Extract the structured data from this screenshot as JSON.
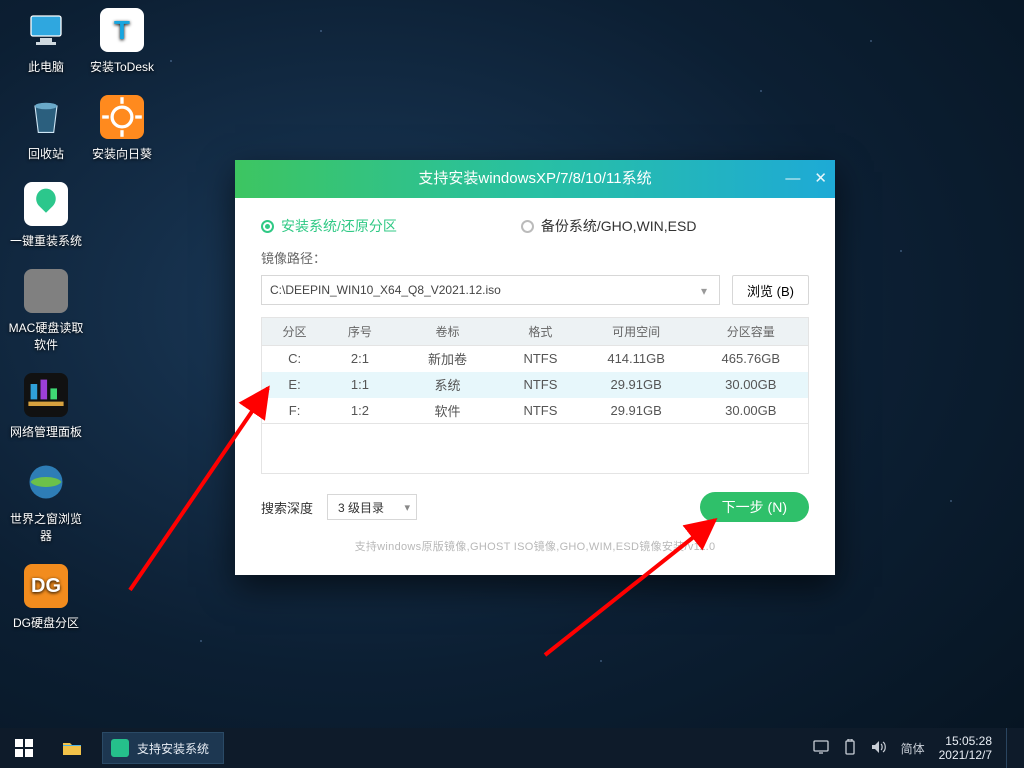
{
  "desktop": [
    {
      "name": "此电脑",
      "icon": "pc"
    },
    {
      "name": "回收站",
      "icon": "bin"
    },
    {
      "name": "一键重装系统",
      "icon": "cloud"
    },
    {
      "name": "MAC硬盘读取软件",
      "icon": "mac"
    },
    {
      "name": "网络管理面板",
      "icon": "net"
    },
    {
      "name": "世界之窗浏览器",
      "icon": "globe"
    },
    {
      "name": "DG硬盘分区",
      "icon": "dg"
    }
  ],
  "desktop_col2": [
    {
      "name": "安装ToDesk",
      "icon": "todesk"
    },
    {
      "name": "安装向日葵",
      "icon": "sun"
    }
  ],
  "installer": {
    "title": "支持安装windowsXP/7/8/10/11系统",
    "tab_install": "安装系统/还原分区",
    "tab_backup": "备份系统/GHO,WIN,ESD",
    "path_label": "镜像路径：",
    "path_value": "C:\\DEEPIN_WIN10_X64_Q8_V2021.12.iso",
    "browse": "浏览 (B)",
    "headers": {
      "part": "分区",
      "idx": "序号",
      "vol": "卷标",
      "fmt": "格式",
      "free": "可用空间",
      "cap": "分区容量"
    },
    "rows": [
      {
        "part": "C:",
        "idx": "2:1",
        "vol": "新加卷",
        "fmt": "NTFS",
        "free": "414.11GB",
        "cap": "465.76GB",
        "sel": false
      },
      {
        "part": "E:",
        "idx": "1:1",
        "vol": "系统",
        "fmt": "NTFS",
        "free": "29.91GB",
        "cap": "30.00GB",
        "sel": true
      },
      {
        "part": "F:",
        "idx": "1:2",
        "vol": "软件",
        "fmt": "NTFS",
        "free": "29.91GB",
        "cap": "30.00GB",
        "sel": false
      }
    ],
    "search_label": "搜索深度",
    "depth": "3 级目录",
    "next": "下一步 (N)",
    "footer": "支持windows原版镜像,GHOST ISO镜像,GHO,WIM,ESD镜像安装/v11.0"
  },
  "taskbar": {
    "task_title": "支持安装系统",
    "ime": "简体",
    "time": "15:05:28",
    "date": "2021/12/7"
  }
}
